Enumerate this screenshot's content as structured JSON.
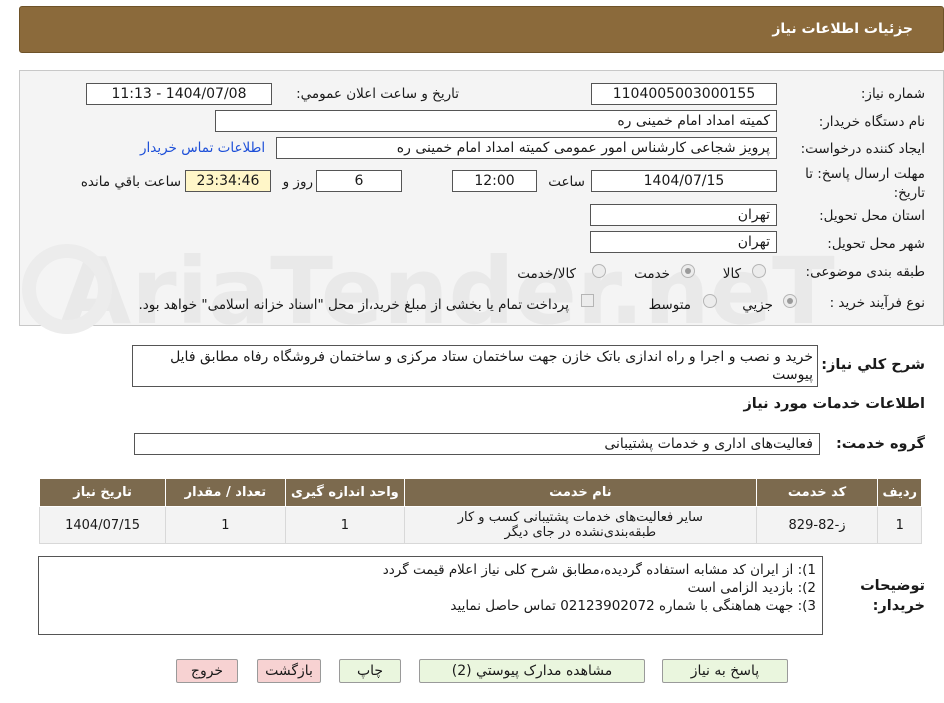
{
  "header": {
    "title": "جزئیات اطلاعات نیاز"
  },
  "watermark": "AriaTender.neT",
  "form": {
    "need_number_label": "شماره نیاز:",
    "need_number": "1104005003000155",
    "announce_label": "تاریخ و ساعت اعلان عمومي:",
    "announce_value": "1404/07/08 - 11:13",
    "buyer_org_label": "نام دستگاه خریدار:",
    "buyer_org": "کمیته امداد امام خمینی ره",
    "requester_label": "ایجاد کننده درخواست:",
    "requester": "پرویز شجاعی کارشناس امور عمومی کمیته امداد امام خمینی ره",
    "contact_link": "اطلاعات تماس خریدار",
    "deadline_label_1": "مهلت ارسال پاسخ: تا",
    "deadline_label_2": "تاریخ:",
    "deadline_date": "1404/07/15",
    "time_label": "ساعت",
    "deadline_time": "12:00",
    "days_value": "6",
    "days_label": "روز و",
    "remaining_time": "23:34:46",
    "remaining_label": "ساعت باقي مانده",
    "province_label": "استان محل تحویل:",
    "province": "تهران",
    "city_label": "شهر محل تحویل:",
    "city": "تهران",
    "category_label": "طبقه بندی موضوعی:",
    "category_options": [
      "کالا",
      "خدمت",
      "کالا/خدمت"
    ],
    "process_label": "نوع فرآیند خرید :",
    "process_options": [
      "جزيي",
      "متوسط"
    ],
    "payment_note": "پرداخت تمام یا بخشی از مبلغ خرید،از محل \"اسناد خزانه اسلامی\" خواهد بود."
  },
  "description": {
    "label": "شرح کلي نياز:",
    "text": "خرید و نصب و اجرا و راه اندازی باتک خازن جهت ساختمان ستاد مرکزی و ساختمان فروشگاه رفاه مطابق فایل پیوست"
  },
  "services": {
    "section_title": "اطلاعات خدمات مورد نياز",
    "group_label": "گروه خدمت:",
    "group_value": "فعالیت‌های اداری و خدمات پشتیبانی",
    "columns": [
      "ردیف",
      "کد خدمت",
      "نام خدمت",
      "واحد اندازه گیری",
      "تعداد / مقدار",
      "تاریخ نیاز"
    ],
    "rows": [
      {
        "row": "1",
        "code": "ز-82-829",
        "name_line1": "سایر فعالیت‌های خدمات پشتیبانی کسب و کار",
        "name_line2": "طبقه‌بندی‌نشده در جای دیگر",
        "unit": "1",
        "qty": "1",
        "date": "1404/07/15"
      }
    ]
  },
  "notes": {
    "label_1": "توضیحات",
    "label_2": "خریدار:",
    "lines": [
      "1): از ایران کد مشابه استفاده گردیده،مطابق شرح کلی نیاز اعلام قیمت گردد",
      "2): بازدید الزامی است",
      "3): جهت هماهنگی با شماره 02123902072 تماس حاصل نمایید"
    ]
  },
  "buttons": {
    "reply": "پاسخ به نیاز",
    "attachments": "مشاهده مدارک پیوستي (2)",
    "print": "چاپ",
    "back": "بازگشت",
    "exit": "خروج"
  },
  "colors": {
    "header_bg": "#8b6a3b",
    "table_header_bg": "#7c6a4e",
    "link": "#1d4fd8",
    "green_btn": "#eaf6de",
    "pink_btn": "#f7d2d2"
  }
}
